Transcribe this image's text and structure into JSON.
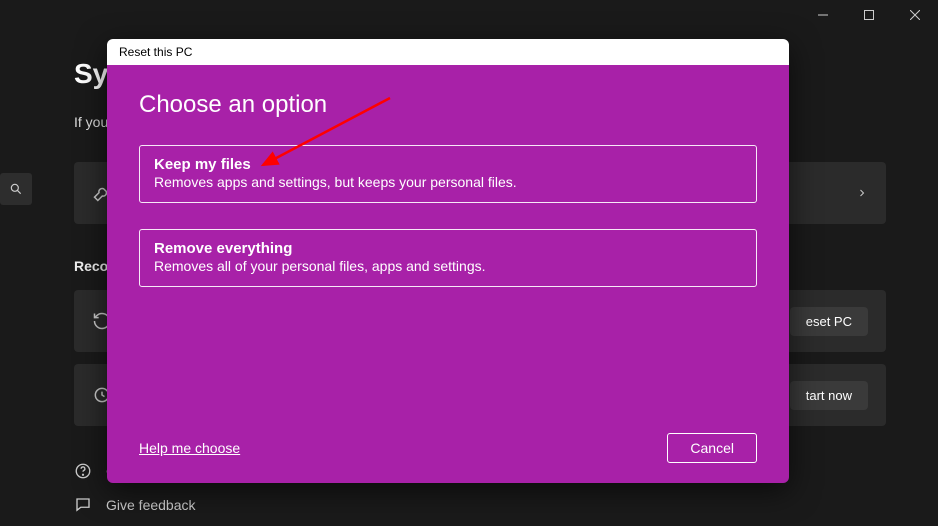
{
  "window": {
    "minimize_title": "Minimize",
    "maximize_title": "Maximize",
    "close_title": "Close"
  },
  "background": {
    "header_fragment": "Sys",
    "subtext_fragment": "If you'",
    "recovery_label": "Recove",
    "card2_button": "eset PC",
    "card3_button": "tart now",
    "feedback1_fragment": "G",
    "feedback2": "Give feedback"
  },
  "dialog": {
    "title": "Reset this PC",
    "heading": "Choose an option",
    "options": [
      {
        "title": "Keep my files",
        "desc": "Removes apps and settings, but keeps your personal files."
      },
      {
        "title": "Remove everything",
        "desc": "Removes all of your personal files, apps and settings."
      }
    ],
    "help_link": "Help me choose",
    "cancel": "Cancel"
  },
  "colors": {
    "dialog_bg": "#a821a8",
    "page_bg": "#1a1a1a",
    "card_bg": "#2b2b2b",
    "arrow": "#ff0000"
  }
}
